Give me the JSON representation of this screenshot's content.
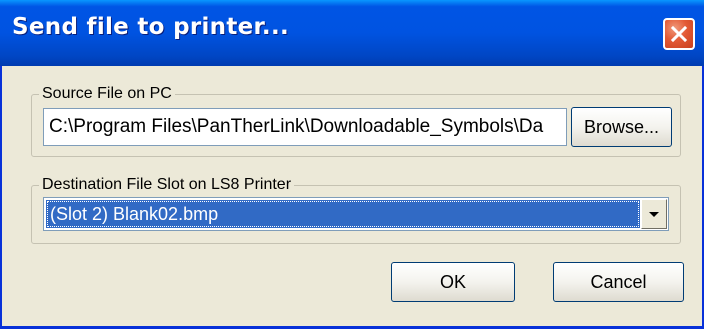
{
  "dialog": {
    "title": "Send file to printer...",
    "close_icon": "close-icon"
  },
  "source": {
    "legend": "Source File on PC",
    "path_value": "C:\\Program Files\\PanTherLink\\Downloadable_Symbols\\Da",
    "browse_label": "Browse..."
  },
  "destination": {
    "legend": "Destination File Slot on LS8 Printer",
    "selected_value": "(Slot 2)  Blank02.bmp",
    "dropdown_icon": "chevron-down-icon"
  },
  "buttons": {
    "ok_label": "OK",
    "cancel_label": "Cancel"
  },
  "colors": {
    "titlebar": "#0053e1",
    "face": "#ece9d8",
    "selection": "#316ac5",
    "close": "#e35a35"
  }
}
